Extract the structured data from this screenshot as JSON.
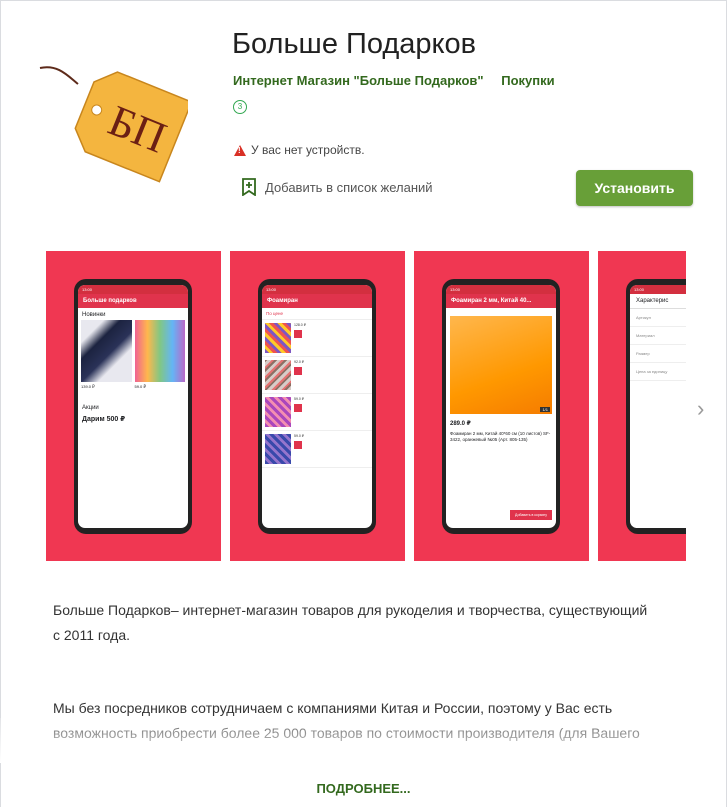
{
  "app": {
    "title": "Больше Подарков",
    "developer": "Интернет Магазин \"Больше Подарков\"",
    "category": "Покупки",
    "rating_badge": "3",
    "logo_text": "БП",
    "warning": "У вас нет устройств.",
    "wishlist_label": "Добавить в список желаний",
    "install_label": "Установить"
  },
  "screenshots": [
    {
      "screen_title": "Больше подарков",
      "section": "Новинки",
      "section2": "Акции",
      "price1": "139.0 ₽",
      "price2": "59.0 ₽",
      "promo": "Дарим 500 ₽"
    },
    {
      "screen_title": "Фоамиран",
      "filter": "По цене",
      "price1": "128.0 ₽",
      "price2": "92.0 ₽",
      "price3": "59.0 ₽",
      "price4": "59.0 ₽"
    },
    {
      "screen_title": "Фоамиран 2 мм, Китай 40...",
      "price": "289.0 ₽",
      "product": "Фоамиран 2 мм, Китай 40*60 см (10 листов) SF-3422, оранжевый №05 (Арт. 805-135)",
      "cart_button": "Добавить в корзину",
      "counter": "1/1"
    },
    {
      "screen_title": "Характерис",
      "rows": [
        "Артикул",
        "Материал",
        "Размер",
        "Цена за единицу"
      ]
    }
  ],
  "description": {
    "para1": "Больше Подарков– интернет-магазин товаров для рукоделия и творчества, существующий с 2011 года.",
    "para2": "Мы без посредников сотрудничаем с компаниями Китая и России, поэтому у Вас есть возможность приобрести более 25 000 товаров по стоимости производителя (для Вашего",
    "more_label": "ПОДРОБНЕЕ..."
  },
  "colors": {
    "accent": "#689f38",
    "link": "#33691e",
    "screenshot_bg": "#f03752",
    "app_bar": "#e0334c"
  }
}
